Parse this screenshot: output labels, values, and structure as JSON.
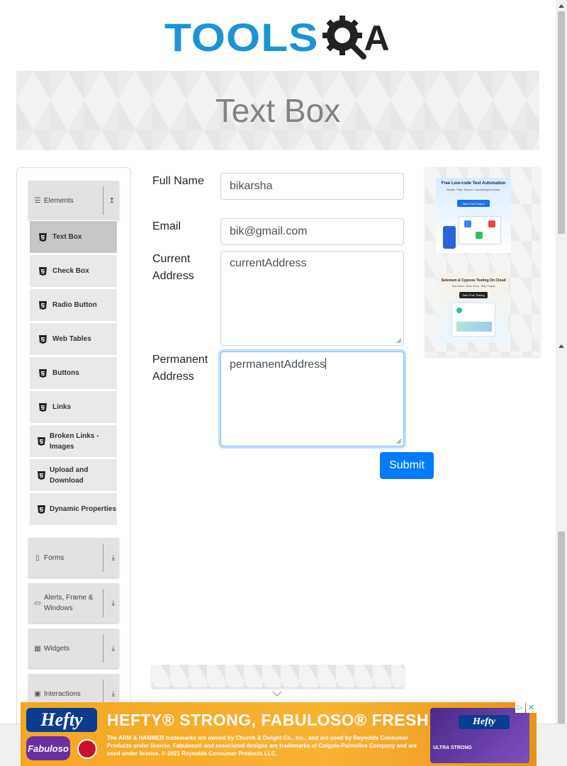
{
  "logo": {
    "text": "TOOLS",
    "suffix": "A",
    "brand_color": "#1c93d3"
  },
  "banner": {
    "title": "Text Box"
  },
  "sidebar": {
    "groups": [
      {
        "label": "Elements",
        "icon": "list-icon",
        "expanded": true,
        "arrow": "↥"
      },
      {
        "label": "Forms",
        "icon": "document-icon",
        "expanded": false,
        "arrow": "⤓"
      },
      {
        "label": "Alerts, Frame & Windows",
        "icon": "window-icon",
        "expanded": false,
        "arrow": "⤓"
      },
      {
        "label": "Widgets",
        "icon": "grid-icon",
        "expanded": false,
        "arrow": "⤓"
      },
      {
        "label": "Interactions",
        "icon": "square-icon",
        "expanded": false,
        "arrow": "⤓"
      }
    ],
    "items": [
      {
        "label": "Text Box",
        "active": true
      },
      {
        "label": "Check Box"
      },
      {
        "label": "Radio Button"
      },
      {
        "label": "Web Tables"
      },
      {
        "label": "Buttons"
      },
      {
        "label": "Links"
      },
      {
        "label": "Broken Links - Images"
      },
      {
        "label": "Upload and Download"
      },
      {
        "label": "Dynamic Properties"
      }
    ]
  },
  "form": {
    "full_name": {
      "label": "Full Name",
      "value": "bikarsha"
    },
    "email": {
      "label": "Email",
      "value": "bik@gmail.com"
    },
    "current_address": {
      "label": "Current Address",
      "value": "currentAddress"
    },
    "permanent_address": {
      "label": "Permanent Address",
      "value": "permanentAddress"
    },
    "submit_label": "Submit",
    "accent_color": "#007bff"
  },
  "right_ads": {
    "ad1": {
      "title": "Free Low-code Test Automation",
      "sub": "Simple. Fast. Secure. Community's choice.",
      "button": "Start Free Project"
    },
    "ad2": {
      "title": "Selenium & Cypress Testing On Cloud",
      "sub": "Test More, Save More, Ship Faster",
      "button": "Start Free Testing"
    }
  },
  "bottom_ad": {
    "brand": "Hefty",
    "second_brand": "Fabuloso",
    "headline": "HEFTY® STRONG, FABULOSO® FRESH",
    "fine_print": "The ARM & HAMMER trademarks are owned by Church & Dwight Co., Inc., and are used by Reynolds Consumer Products under license. Fabuloso® and associated designs are trademarks of Colgate-Palmolive Company and are used under license. © 2021 Reynolds Consumer Products LLC.",
    "product_label": "Hefty",
    "product_sub": "ULTRA STRONG",
    "ad_choices": "▷",
    "close": "✕"
  }
}
